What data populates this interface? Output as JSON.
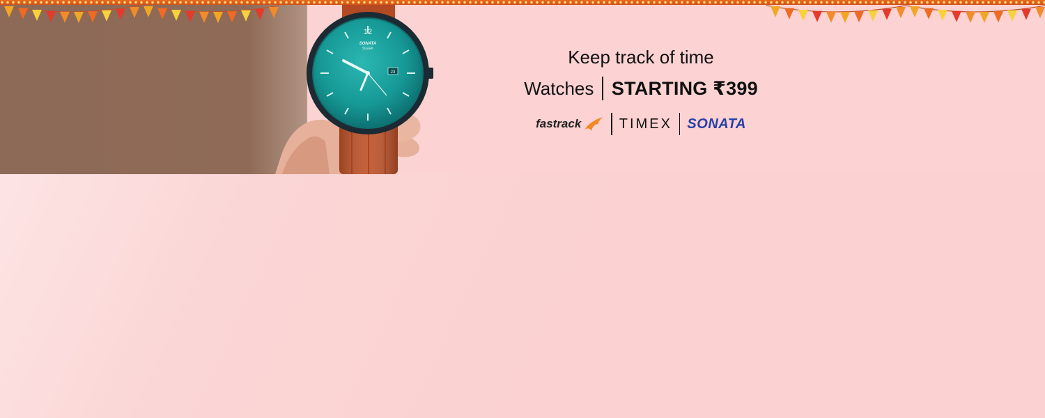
{
  "promo": {
    "headline": "Keep track of time",
    "category": "Watches",
    "price_text": "STARTING ₹399",
    "watch_dial_brand": "SONATA",
    "watch_dial_model": "SLEEK",
    "watch_dial_number": "12",
    "watch_date": "23"
  },
  "brands": [
    {
      "name": "fastrack"
    },
    {
      "name": "TIMEX"
    },
    {
      "name": "SONATA"
    }
  ],
  "colors": {
    "background": "#fbd3d3",
    "photo_backdrop": "#8c6a57",
    "dial": "#1a9e9b",
    "strap": "#c0532a",
    "sonata_blue": "#2740a8",
    "fastrack_orange": "#f08a24"
  },
  "icons": {
    "decoration": "bunting-flags",
    "fastrack_logo": "fastrack-wing-icon"
  }
}
